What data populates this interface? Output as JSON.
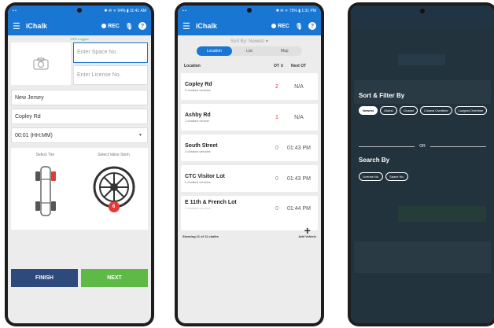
{
  "app": {
    "title": "iChalk",
    "rec_label": "REC"
  },
  "screen1": {
    "status": {
      "left": "▪ ▪",
      "right": "✱ ✉ ᯤ 94% ▮ 11:41 AM"
    },
    "gps": "GPS Logged",
    "space_placeholder": "Enter Space No.",
    "license_placeholder": "Enter License No.",
    "state": "New Jersey",
    "street": "Copley Rd",
    "time_select": "00:01 (HH:MM)",
    "select_tire": "Select Tire",
    "select_valve": "Select Valve Stem",
    "valve_badge": "6",
    "finish": "FINISH",
    "next": "NEXT"
  },
  "screen2": {
    "status": {
      "left": "▪ ▪",
      "right": "✱ ✉ ᯤ 75% ▮ 1:31 PM"
    },
    "sort_label": "Sort By: Newest ▾",
    "tabs": [
      "Location",
      "List",
      "Map"
    ],
    "headers": {
      "location": "Location",
      "ot": "OT",
      "next_ot": "Next OT"
    },
    "items": [
      {
        "name": "Copley Rd",
        "sub": "2 chalked vehicles",
        "ot": "2",
        "next": "N/A"
      },
      {
        "name": "Ashby Rd",
        "sub": "1 chalked vehicle",
        "ot": "1",
        "next": "N/A"
      },
      {
        "name": "South Street",
        "sub": "4 chalked vehicles",
        "ot": "0",
        "next": "01:43 PM"
      },
      {
        "name": "CTC Visitor Lot",
        "sub": "2 chalked vehicles",
        "ot": "0",
        "next": "01:43 PM"
      },
      {
        "name": "E 11th & French Lot",
        "sub": "2 chalked vehicles",
        "ot": "0",
        "next": "01:44 PM"
      }
    ],
    "showing": "Showing 11 of 11 chalks",
    "add_vehicle": "Add Vehicle"
  },
  "screen3": {
    "sort_title": "Sort & Filter By",
    "chips": [
      "Newest",
      "Oldest",
      "Closest",
      "Closest Overtime",
      "Longest Overtime"
    ],
    "or": "OR",
    "search_title": "Search By",
    "search_chips": [
      "License No.",
      "Space No."
    ]
  },
  "colors": {
    "primary": "#1976d2",
    "finish": "#2e4a7d",
    "next": "#5fb946",
    "overtime": "#e53935"
  }
}
